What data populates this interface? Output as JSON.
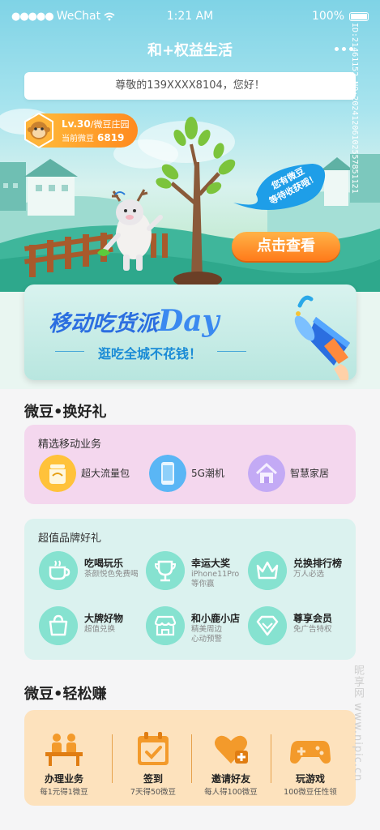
{
  "status_bar": {
    "signal": "●●●●●",
    "carrier": "WeChat",
    "time": "1:21 AM",
    "battery": "100%"
  },
  "nav": {
    "title": "和+权益生活"
  },
  "greeting": "尊敬的139XXXX8104，您好！",
  "level": {
    "level": "Lv.30",
    "garden": "/微豆庄园",
    "beans_label": "当前微豆",
    "beans": "6819"
  },
  "hero": {
    "bubble_line1": "您有微豆",
    "bubble_line2": "等待收获哦！",
    "button": "点击查看"
  },
  "banner": {
    "title": "移动吃货派",
    "title_en": "Day",
    "subtitle": "逛吃全城不花钱！"
  },
  "section1": {
    "title": "微豆•换好礼",
    "mobile_card": {
      "title": "精选移动业务",
      "items": [
        {
          "label": "超大流量包",
          "icon": "data-jar-icon",
          "color": "#ffc23a"
        },
        {
          "label": "5G潮机",
          "icon": "phone-icon",
          "color": "#5ab6f5"
        },
        {
          "label": "智慧家居",
          "icon": "house-icon",
          "color": "#b89af0"
        }
      ]
    },
    "brand_card": {
      "title": "超值品牌好礼",
      "items": [
        {
          "title": "吃喝玩乐",
          "desc": "茶颜悦色免费喝",
          "icon": "coffee-cup-icon"
        },
        {
          "title": "幸运大奖",
          "desc": "iPhone11Pro\n等你赢",
          "icon": "trophy-icon"
        },
        {
          "title": "兑换排行榜",
          "desc": "万人必选",
          "icon": "crown-icon"
        },
        {
          "title": "大牌好物",
          "desc": "超值兑换",
          "icon": "shopping-bag-icon"
        },
        {
          "title": "和小鹿小店",
          "desc": "精美周边\n心动预警",
          "icon": "shop-icon"
        },
        {
          "title": "尊享会员",
          "desc": "免广告特权",
          "icon": "vip-diamond-icon"
        }
      ]
    }
  },
  "section2": {
    "title": "微豆•轻松赚",
    "items": [
      {
        "title": "办理业务",
        "desc": "每1元得1微豆",
        "icon": "counter-service-icon"
      },
      {
        "title": "签到",
        "desc": "7天得50微豆",
        "icon": "calendar-check-icon"
      },
      {
        "title": "邀请好友",
        "desc": "每人得100微豆",
        "icon": "heart-plus-icon"
      },
      {
        "title": "玩游戏",
        "desc": "100微豆任性领",
        "icon": "gamepad-icon"
      }
    ]
  },
  "watermark": {
    "id": "ID:21461152 NO:20241206102557851121",
    "side": "昵享网 www.nipic.cn"
  },
  "colors": {
    "accent_orange": "#ff8a1f",
    "pink_card": "#f4d7ee",
    "mint_card": "#dbf2ef",
    "peach_card": "#fde2bd",
    "brand_blue": "#2b6ee0"
  }
}
